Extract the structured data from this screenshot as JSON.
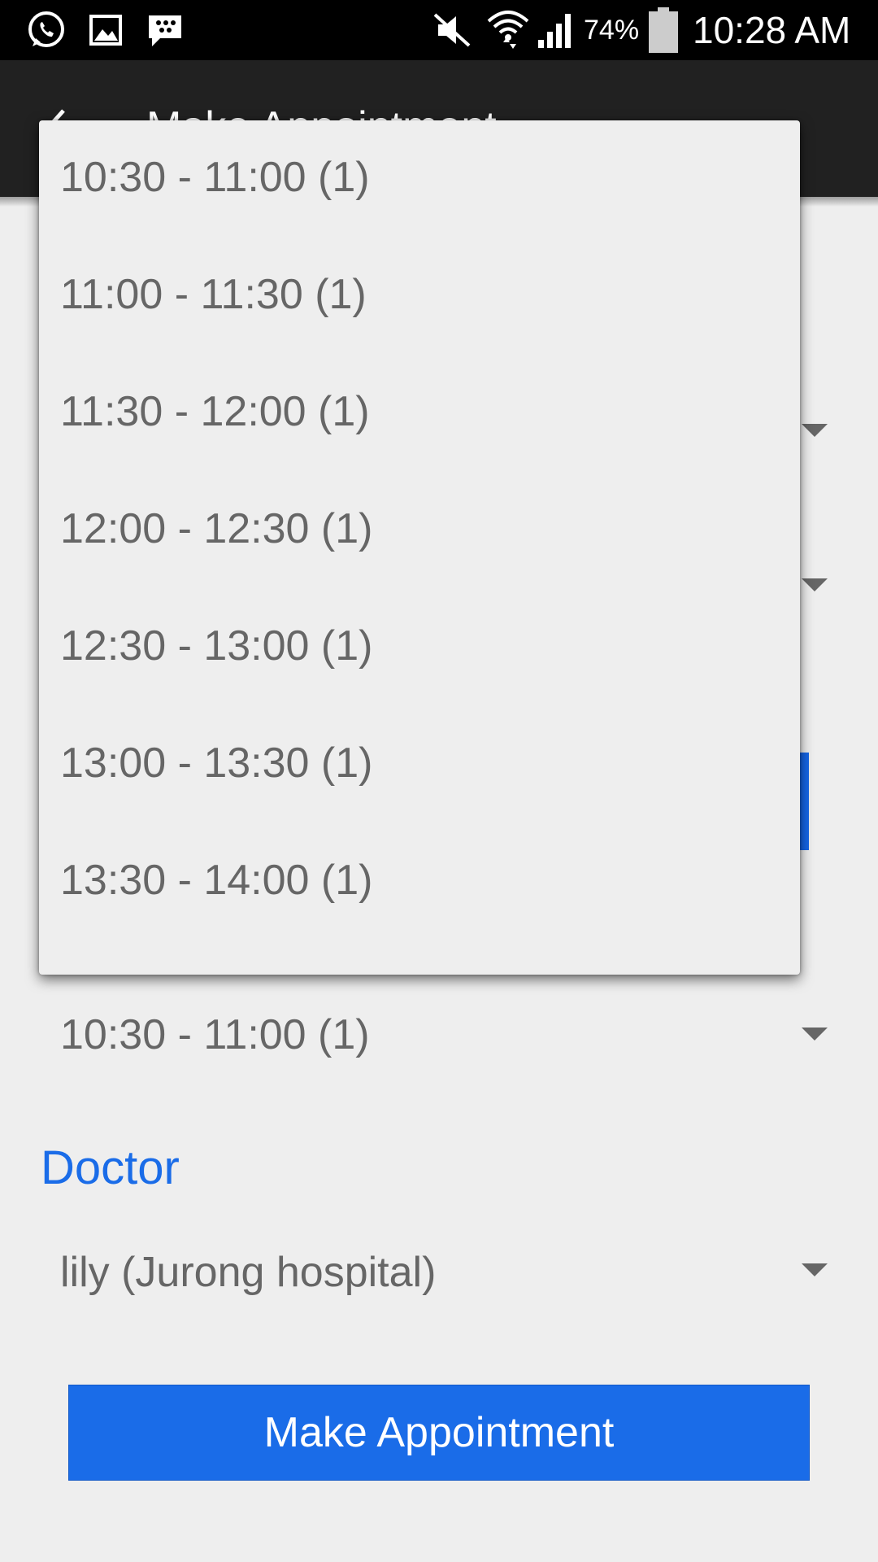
{
  "status_bar": {
    "battery_percent": "74%",
    "time": "10:28 AM",
    "icons": [
      "whatsapp-icon",
      "gallery-icon",
      "bbm-icon",
      "mute-icon",
      "wifi-icon",
      "signal-icon",
      "battery-icon"
    ]
  },
  "app_bar": {
    "title": "Make Appointment",
    "back_icon": "back-arrow-icon"
  },
  "form": {
    "time_slot": {
      "selected": "10:30 - 11:00 (1)"
    },
    "doctor": {
      "label": "Doctor",
      "selected": "lily (Jurong hospital)"
    },
    "submit_label": "Make Appointment"
  },
  "dropdown": {
    "options": [
      "10:30 - 11:00 (1)",
      "11:00 - 11:30 (1)",
      "11:30 - 12:00 (1)",
      "12:00 - 12:30 (1)",
      "12:30 - 13:00 (1)",
      "13:00 - 13:30 (1)",
      "13:30 - 14:00 (1)"
    ]
  },
  "colors": {
    "accent": "#1a6ce8",
    "app_bar": "#212121",
    "background": "#eeeeee",
    "text_secondary": "#666666"
  }
}
